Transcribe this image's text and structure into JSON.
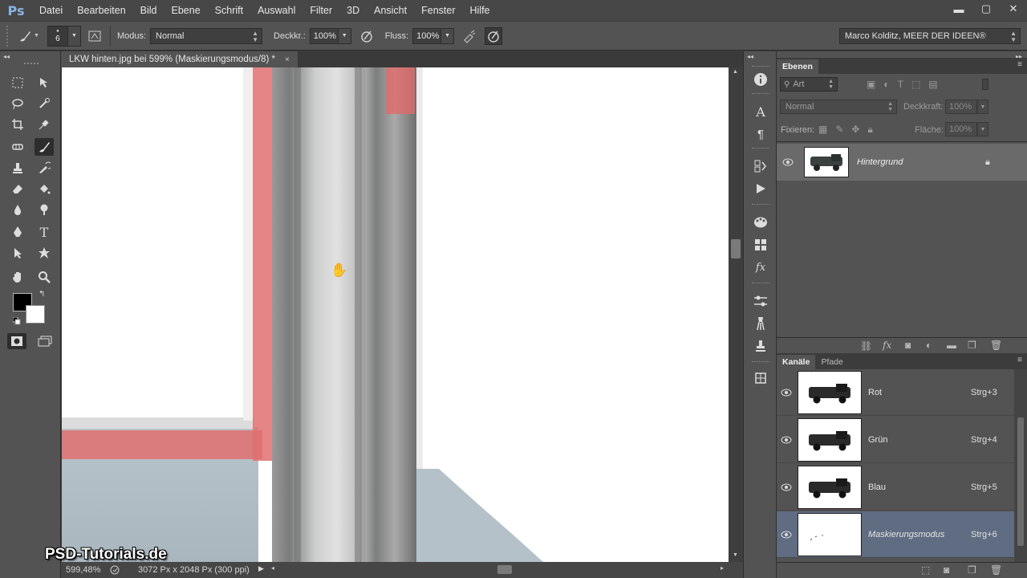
{
  "app": {
    "logo": "Ps"
  },
  "menu": [
    "Datei",
    "Bearbeiten",
    "Bild",
    "Ebene",
    "Schrift",
    "Auswahl",
    "Filter",
    "3D",
    "Ansicht",
    "Fenster",
    "Hilfe"
  ],
  "window_controls": {
    "minimize": "▬",
    "maximize": "▢",
    "close": "✕"
  },
  "options": {
    "brush_size": "6",
    "mode_label": "Modus:",
    "mode_value": "Normal",
    "opacity_label": "Deckkr.:",
    "opacity_value": "100%",
    "flow_label": "Fluss:",
    "flow_value": "100%",
    "workspace": "Marco Kolditz, MEER DER IDEEN®"
  },
  "document": {
    "tab_title": "LKW hinten.jpg bei 599% (Maskierungsmodus/8) *",
    "close": "×",
    "zoom": "599,48%",
    "doc_info": "3072 Px x 2048 Px (300 ppi)"
  },
  "watermark": "PSD-Tutorials.de",
  "layers_panel": {
    "tab": "Ebenen",
    "filter_label": "Art",
    "blend_mode": "Normal",
    "opacity_label": "Deckkraft:",
    "opacity_value": "100%",
    "lock_label": "Fixieren:",
    "fill_label": "Fläche:",
    "fill_value": "100%",
    "layers": [
      {
        "name": "Hintergrund",
        "visible": true,
        "locked": true
      }
    ]
  },
  "channels_panel": {
    "tabs": [
      "Kanäle",
      "Pfade"
    ],
    "channels": [
      {
        "name": "Rot",
        "shortcut": "Strg+3",
        "selected": false
      },
      {
        "name": "Grün",
        "shortcut": "Strg+4",
        "selected": false
      },
      {
        "name": "Blau",
        "shortcut": "Strg+5",
        "selected": false
      },
      {
        "name": "Maskierungsmodus",
        "shortcut": "Strg+6",
        "selected": true
      }
    ]
  },
  "colors": {
    "foreground": "#000000",
    "background": "#ffffff",
    "mask_overlay": "#e06a6a",
    "selected_row": "#5f6c82"
  }
}
